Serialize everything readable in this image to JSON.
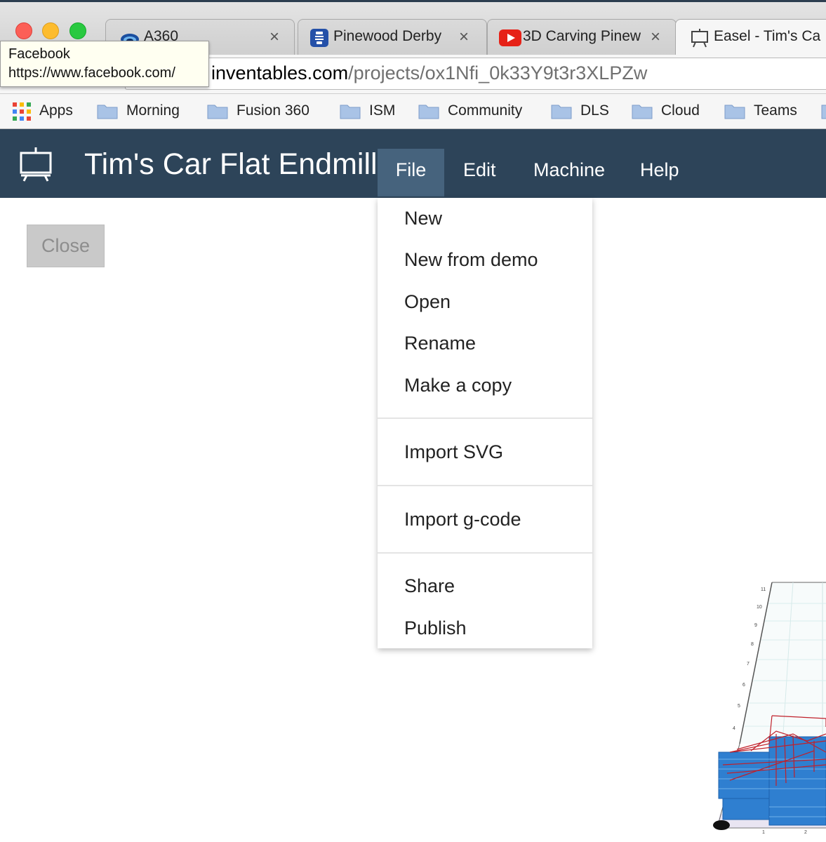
{
  "window": {
    "tabs": [
      {
        "title": "A360",
        "favicon": "a360-icon",
        "close": "×"
      },
      {
        "title": "Pinewood Derby",
        "favicon": "pinewood-icon",
        "close": "×"
      },
      {
        "title": "3D Carving Pinew",
        "favicon": "youtube-icon",
        "close": "×"
      },
      {
        "title": "Easel - Tim's Ca",
        "favicon": "easel-icon"
      }
    ],
    "tooltip": {
      "title": "Facebook",
      "url": "https://www.facebook.com/"
    },
    "address": {
      "host": "inventables.com",
      "path": "/projects/ox1Nfi_0k33Y9t3r3XLPZw"
    },
    "bookmarks": [
      {
        "label": "Apps",
        "icon": "apps-grid-icon"
      },
      {
        "label": "Morning",
        "icon": "folder-icon"
      },
      {
        "label": "Fusion 360",
        "icon": "folder-icon"
      },
      {
        "label": "ISM",
        "icon": "folder-icon"
      },
      {
        "label": "Community",
        "icon": "folder-icon"
      },
      {
        "label": "DLS",
        "icon": "folder-icon"
      },
      {
        "label": "Cloud",
        "icon": "folder-icon"
      },
      {
        "label": "Teams",
        "icon": "folder-icon"
      }
    ]
  },
  "app": {
    "logo": "easel-logo-icon",
    "project_title": "Tim's Car Flat Endmill",
    "menu": [
      "File",
      "Edit",
      "Machine",
      "Help"
    ],
    "open_menu": "File",
    "close_label": "Close",
    "file_menu": {
      "group1": [
        "New",
        "New from demo",
        "Open",
        "Rename",
        "Make a copy"
      ],
      "group2": [
        "Import SVG"
      ],
      "group3": [
        "Import g-code"
      ],
      "group4": [
        "Share",
        "Publish"
      ]
    },
    "preview": {
      "axis_ticks": [
        "11",
        "10",
        "9",
        "8",
        "7",
        "6",
        "5",
        "4",
        "1",
        "2"
      ]
    }
  },
  "colors": {
    "appbar": "#2d4459",
    "menu_open": "#46637d",
    "toolpath_red": "#c0202a",
    "toolpath_blue": "#2f7fd0"
  }
}
